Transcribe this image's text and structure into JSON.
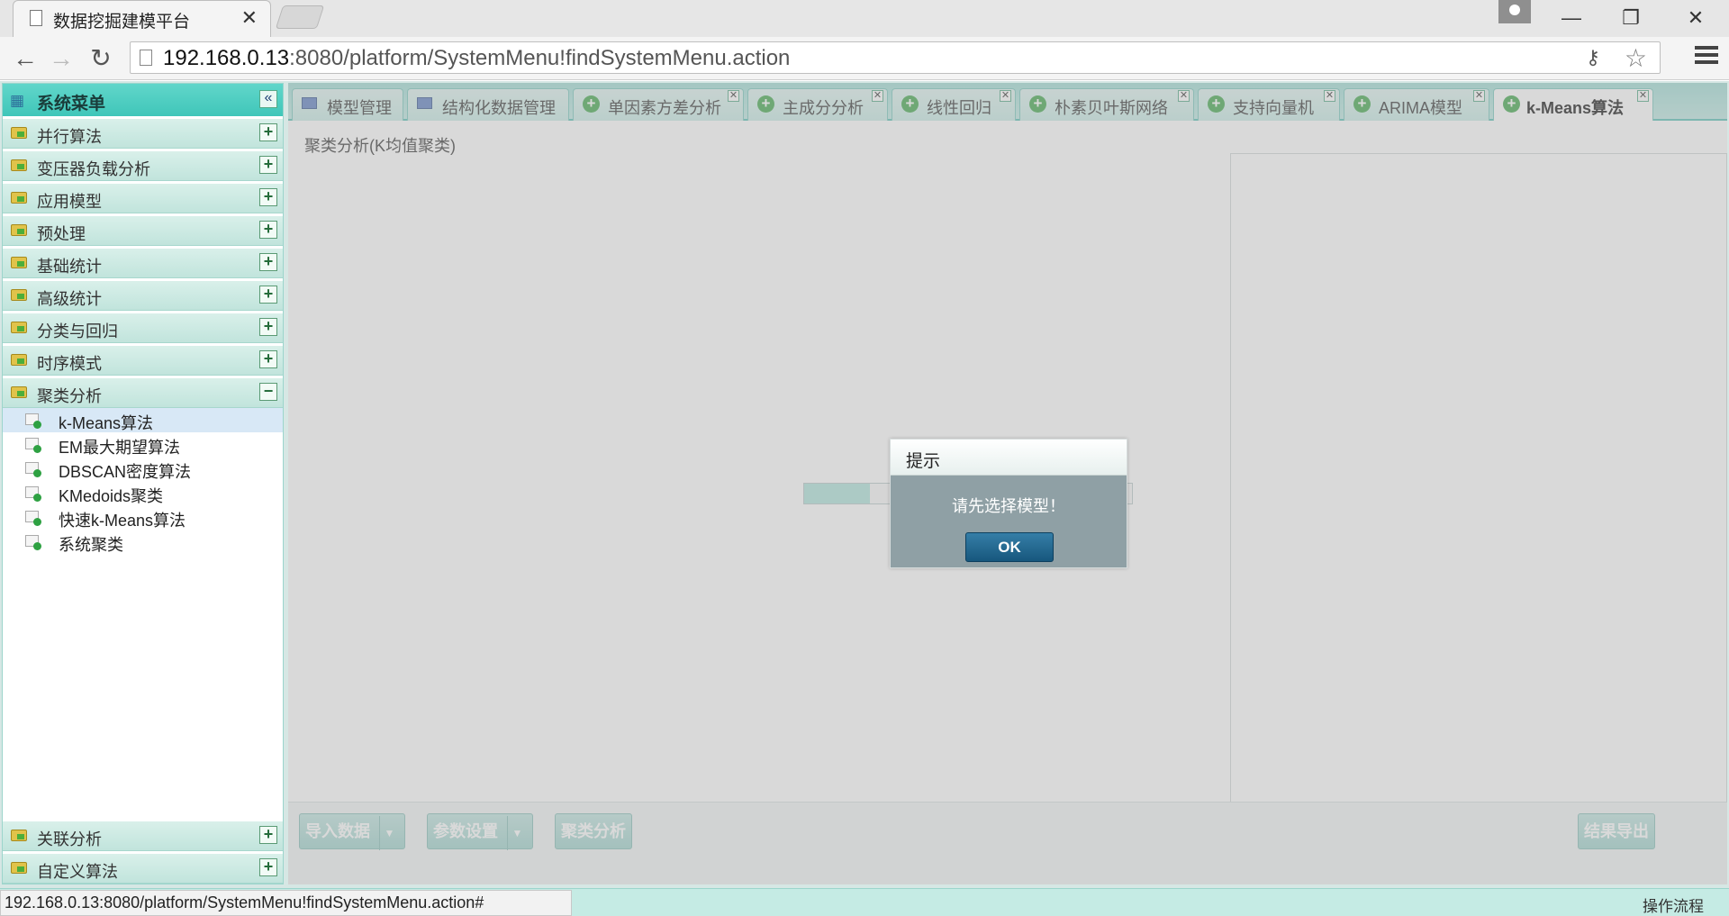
{
  "browser": {
    "tab_title": "数据挖掘建模平台",
    "url_host": "192.168.0.13",
    "url_path": ":8080/platform/SystemMenu!findSystemMenu.action",
    "status_url": "192.168.0.13:8080/platform/SystemMenu!findSystemMenu.action#"
  },
  "sidebar": {
    "title": "系统菜单",
    "categories": [
      {
        "label": "并行算法",
        "state": "+"
      },
      {
        "label": "变压器负载分析",
        "state": "+"
      },
      {
        "label": "应用模型",
        "state": "+"
      },
      {
        "label": "预处理",
        "state": "+"
      },
      {
        "label": "基础统计",
        "state": "+"
      },
      {
        "label": "高级统计",
        "state": "+"
      },
      {
        "label": "分类与回归",
        "state": "+"
      },
      {
        "label": "时序模式",
        "state": "+"
      },
      {
        "label": "聚类分析",
        "state": "−"
      }
    ],
    "sub_items": [
      "k-Means算法",
      "EM最大期望算法",
      "DBSCAN密度算法",
      "KMedoids聚类",
      "快速k-Means算法",
      "系统聚类"
    ],
    "bottom_categories": [
      {
        "label": "关联分析",
        "state": "+"
      },
      {
        "label": "自定义算法",
        "state": "+"
      }
    ]
  },
  "tabs": [
    "模型管理",
    "结构化数据管理",
    "单因素方差分析",
    "主成分分析",
    "线性回归",
    "朴素贝叶斯网络",
    "支持向量机",
    "ARIMA模型",
    "k-Means算法"
  ],
  "panel": {
    "title": "聚类分析(K均值聚类)",
    "buttons": {
      "import": "导入数据",
      "params": "参数设置",
      "cluster": "聚类分析",
      "export": "结果导出"
    }
  },
  "dialog": {
    "title": "提示",
    "message": "请先选择模型！",
    "ok": "OK"
  },
  "status": {
    "flow": "操作流程"
  },
  "colors": {
    "accent": "#3fc6b9",
    "ok_button": "#17577d"
  }
}
